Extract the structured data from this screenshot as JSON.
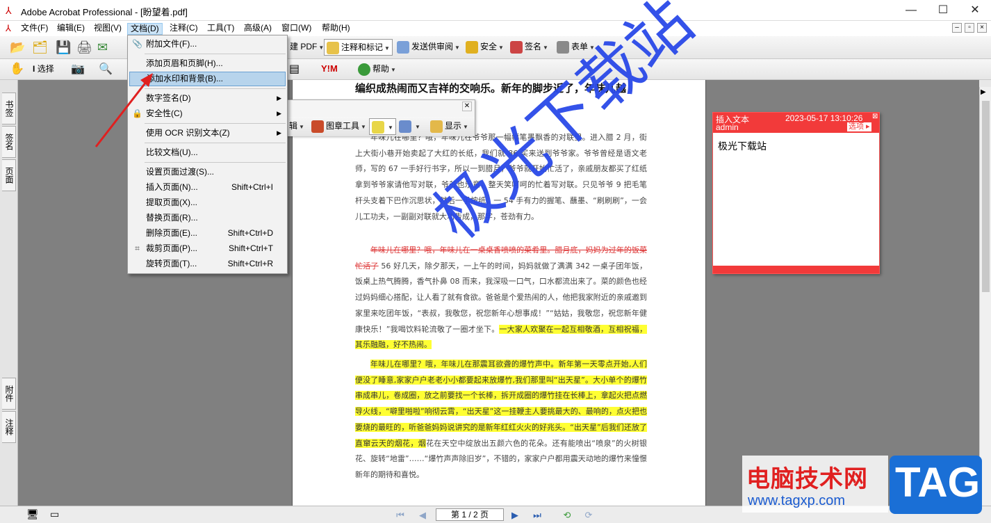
{
  "window": {
    "title": "Adobe Acrobat Professional - [盼望着.pdf]",
    "minimize": "—",
    "maximize": "☐",
    "close": "✕"
  },
  "menubar": {
    "items": [
      "文件(F)",
      "编辑(E)",
      "视图(V)",
      "文档(D)",
      "注释(C)",
      "工具(T)",
      "高级(A)",
      "窗口(W)",
      "帮助(H)"
    ],
    "mdi_buttons": [
      "–",
      "▫",
      "×"
    ]
  },
  "toolbar1": {
    "create_pdf": "建 PDF",
    "comment_markup": "注释和标记",
    "send_review": "发送供审阅",
    "security": "安全",
    "sign": "签名",
    "forms": "表单"
  },
  "toolbar2": {
    "select": "选择",
    "help": "帮助"
  },
  "floating_toolbar": {
    "edit_suffix": "辑",
    "stamp_tool": "图章工具",
    "show": "显示"
  },
  "left_tabs": [
    "书签",
    "签名",
    "页面",
    "附件",
    "注释"
  ],
  "dropdown": {
    "items": [
      {
        "label": "附加文件(F)...",
        "shortcut": "",
        "icon": "paperclip-icon",
        "submenu": false
      },
      {
        "label": "添加页眉和页脚(H)...",
        "shortcut": "",
        "icon": "",
        "submenu": false
      },
      {
        "label": "添加水印和背景(B)...",
        "shortcut": "",
        "icon": "",
        "submenu": false,
        "highlighted": true
      },
      {
        "label": "数字签名(D)",
        "shortcut": "",
        "icon": "",
        "submenu": true
      },
      {
        "label": "安全性(C)",
        "shortcut": "",
        "icon": "lock-icon",
        "submenu": true
      },
      {
        "label": "使用 OCR 识别文本(Z)",
        "shortcut": "",
        "icon": "",
        "submenu": true
      },
      {
        "label": "比较文档(U)...",
        "shortcut": "",
        "icon": "",
        "submenu": false
      },
      {
        "label": "设置页面过渡(S)...",
        "shortcut": "",
        "icon": "",
        "submenu": false
      },
      {
        "label": "插入页面(N)...",
        "shortcut": "Shift+Ctrl+I",
        "icon": "",
        "submenu": false
      },
      {
        "label": "提取页面(X)...",
        "shortcut": "",
        "icon": "",
        "submenu": false
      },
      {
        "label": "替换页面(R)...",
        "shortcut": "",
        "icon": "",
        "submenu": false
      },
      {
        "label": "删除页面(E)...",
        "shortcut": "Shift+Ctrl+D",
        "icon": "",
        "submenu": false
      },
      {
        "label": "裁剪页面(P)...",
        "shortcut": "Shift+Ctrl+T",
        "icon": "crop-icon",
        "submenu": false
      },
      {
        "label": "旋转页面(T)...",
        "shortcut": "Shift+Ctrl+R",
        "icon": "",
        "submenu": false
      }
    ]
  },
  "document": {
    "heading": "编织成热闹而又吉祥的交响乐。新年的脚步近了，年味儿越",
    "p1": "年味儿在哪里？哦，年味儿在爷爷那一幅幅笔墨飘香的对联里。进入腊 2 月，街上大街小巷开始卖起了大红的长纸，我们就 86 买来送到爷爷家。爷爷曾经是语文老师，写的 67 一手好行书字，所以一到腊月，爷爷就开始忙活了，亲戚朋友都买了红纸拿到爷爷家请他写对联，爷爷也乐意，整天笑呵呵的忙着写对联。只见爷爷 9 把毛笔杆头支着下巴作沉思状，然后一手按纸，一 54 手有力的握笔、蘸墨、“刷刷刷”，一会儿工功夫，一副副对联就大功告成，那字，苍劲有力。",
    "p2_strike": "年味儿在哪里？哦，年味儿在一桌桌香喷喷的菜肴里。腊月底，妈妈为过年的饭菜忙活了",
    "p2_rest": " 56 好几天，除夕那天，一上午的时间，妈妈就做了满满 342 一桌子团年饭，饭桌上热气腾腾，香气扑鼻 08 而来，我深吸一口气，口水都流出来了。菜的颜色也经过妈妈细心搭配，让人看了就有食欲。爸爸是个爱热闹的人，他把我家附近的亲戚邀到家里来吃团年饭，“表叔，我敬您，祝您新年心想事成！”“姑姑，我敬您，祝您新年健康快乐！”我喝饮料轮流敬了一圈才坐下。",
    "p2_hl": "一大家人欢聚在一起互相敬酒，互相祝福，其乐融融，好不热闹。",
    "p3_hl": "年味儿在哪里？哦，年味儿在那震耳欲聋的爆竹声中。新年第一天零点开始,人们便没了睡意,家家户户老老小小都要起来放爆竹,我们那里叫“出天星”。大小单个的爆竹串成串儿，卷成圈，放之前要找一个长棒，拆开成圈的爆竹挂在长棒上，拿起火把点燃导火线，“噼里啪啦”响彻云霄，“出天星”这一挂鞭主人要挑最大的、最响的，点火把也要烧的最旺的，听爸爸妈妈说讲究的是新年红红火火的好兆头。“出天星”后我们还放了直窜云天的烟花，烟",
    "p3_rest": "花在天空中绽放出五颜六色的花朵。还有能喷出“喷泉”的火树银花、旋转“地雷”……“爆竹声声除旧岁”，不错的，家家户户都用震天动地的爆竹来憧憬新年的期待和喜悦。",
    "watermark": "极光下载站"
  },
  "note": {
    "title": "插入文本",
    "timestamp": "2023-05-17 13:10:26",
    "author": "admin",
    "options": "选项",
    "body": "极光下载站"
  },
  "statusbar": {
    "page": "第 1 / 2 页"
  },
  "site_logo": {
    "name": "电脑技术网",
    "url": "www.tagxp.com",
    "tag": "TAG"
  },
  "colors": {
    "accent_red": "#f23a3a",
    "watermark_blue": "#2a49e8",
    "highlight_yellow": "#ffff33",
    "menu_hover": "#b7d4ec"
  }
}
